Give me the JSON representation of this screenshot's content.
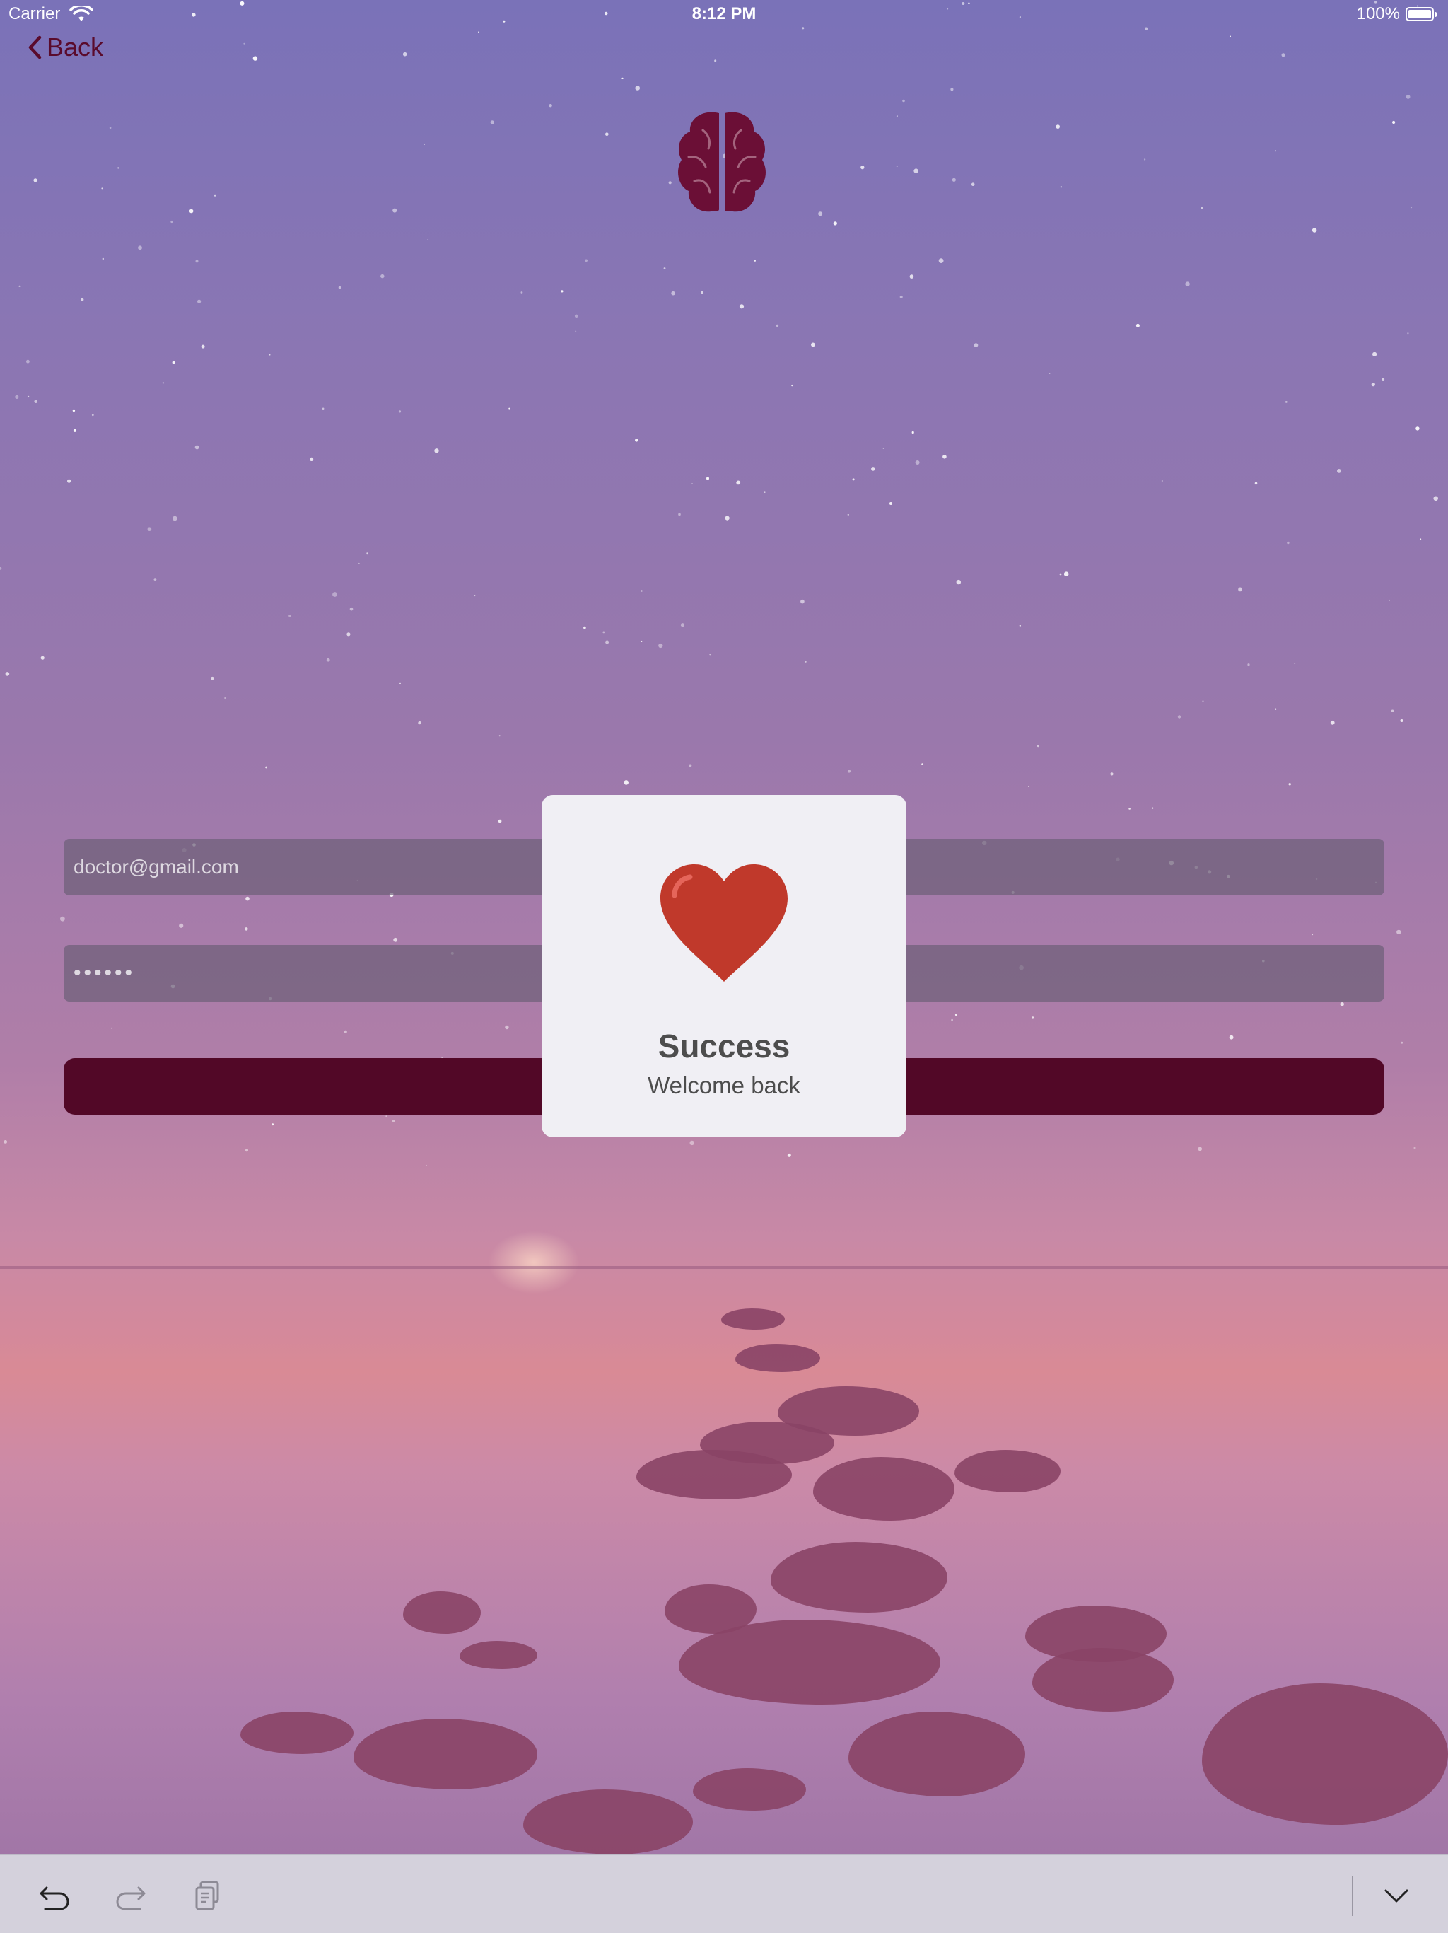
{
  "status_bar": {
    "carrier": "Carrier",
    "time": "8:12 PM",
    "battery": "100%",
    "wifi_icon": "wifi-icon",
    "battery_icon": "battery-icon"
  },
  "nav": {
    "back_label": "Back",
    "back_icon": "chevron-left-icon"
  },
  "logo": {
    "icon": "brain-icon",
    "color": "#6b0f36"
  },
  "login_form": {
    "email_placeholder": "doctor@gmail.com",
    "password_value": "••••••",
    "button_color": "#520827"
  },
  "hud": {
    "icon": "heart-icon",
    "title": "Success",
    "subtitle": "Welcome back",
    "heart_color": "#c0392b"
  },
  "keyboard_toolbar": {
    "undo_icon": "undo-icon",
    "redo_icon": "redo-icon",
    "paste_icon": "paste-icon",
    "hide_keyboard_icon": "chevron-down-icon"
  }
}
